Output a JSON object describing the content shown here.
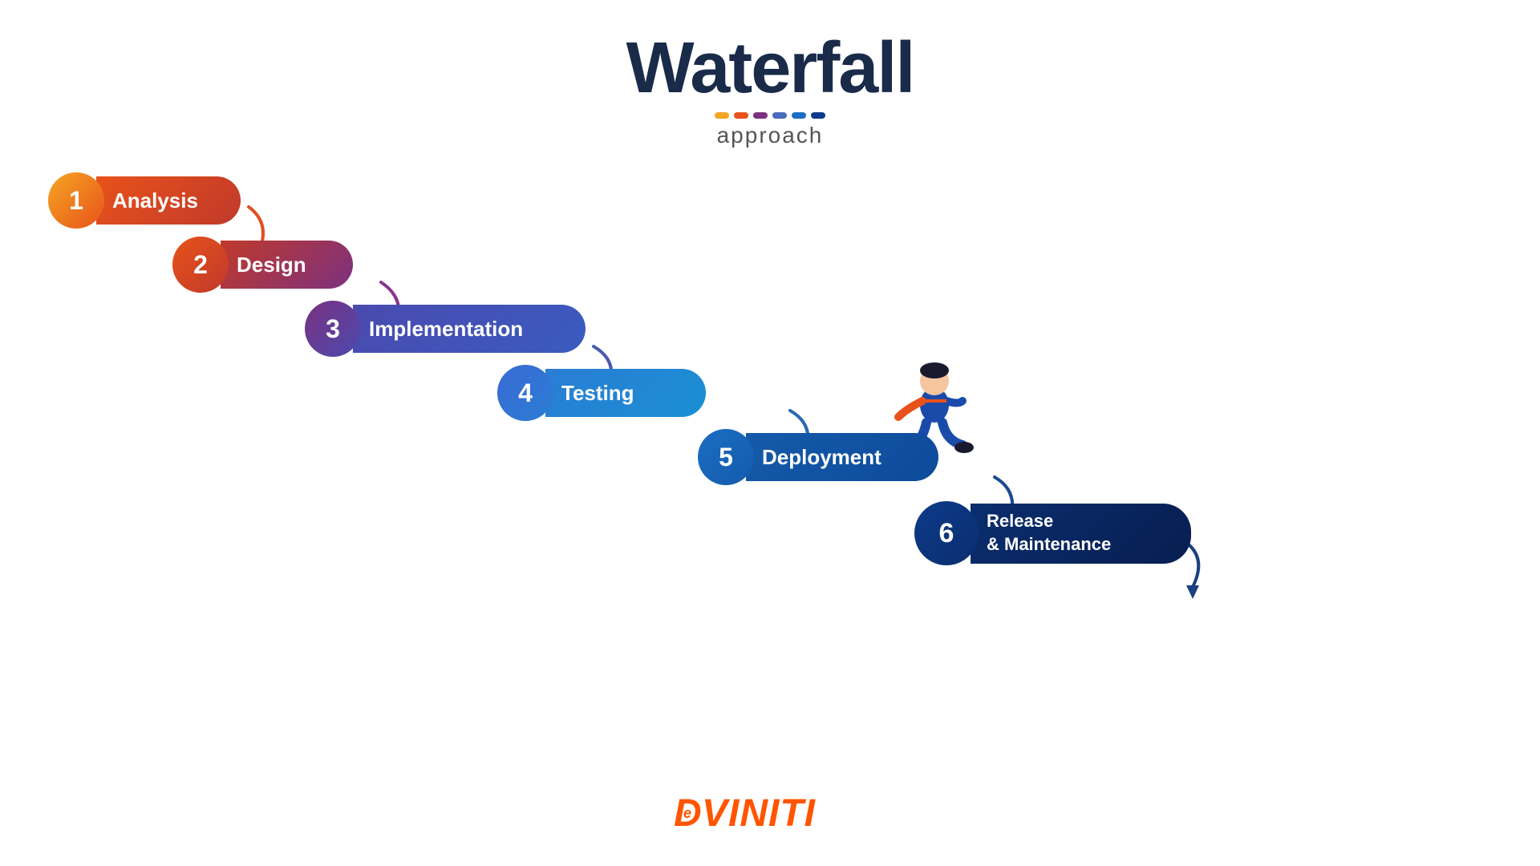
{
  "title": {
    "main": "Waterfall",
    "sub": "approach"
  },
  "dots": [
    {
      "color": "#f5a623"
    },
    {
      "color": "#e8521a"
    },
    {
      "color": "#7b3180"
    },
    {
      "color": "#4a6abf"
    },
    {
      "color": "#1a6ec4"
    },
    {
      "color": "#0d3a8a"
    }
  ],
  "steps": [
    {
      "number": "1",
      "label": "Analysis"
    },
    {
      "number": "2",
      "label": "Design"
    },
    {
      "number": "3",
      "label": "Implementation"
    },
    {
      "number": "4",
      "label": "Testing"
    },
    {
      "number": "5",
      "label": "Deployment"
    },
    {
      "number": "6",
      "label": "Release\n& Maintenance"
    }
  ],
  "logo": {
    "text": "DeVINITI"
  }
}
